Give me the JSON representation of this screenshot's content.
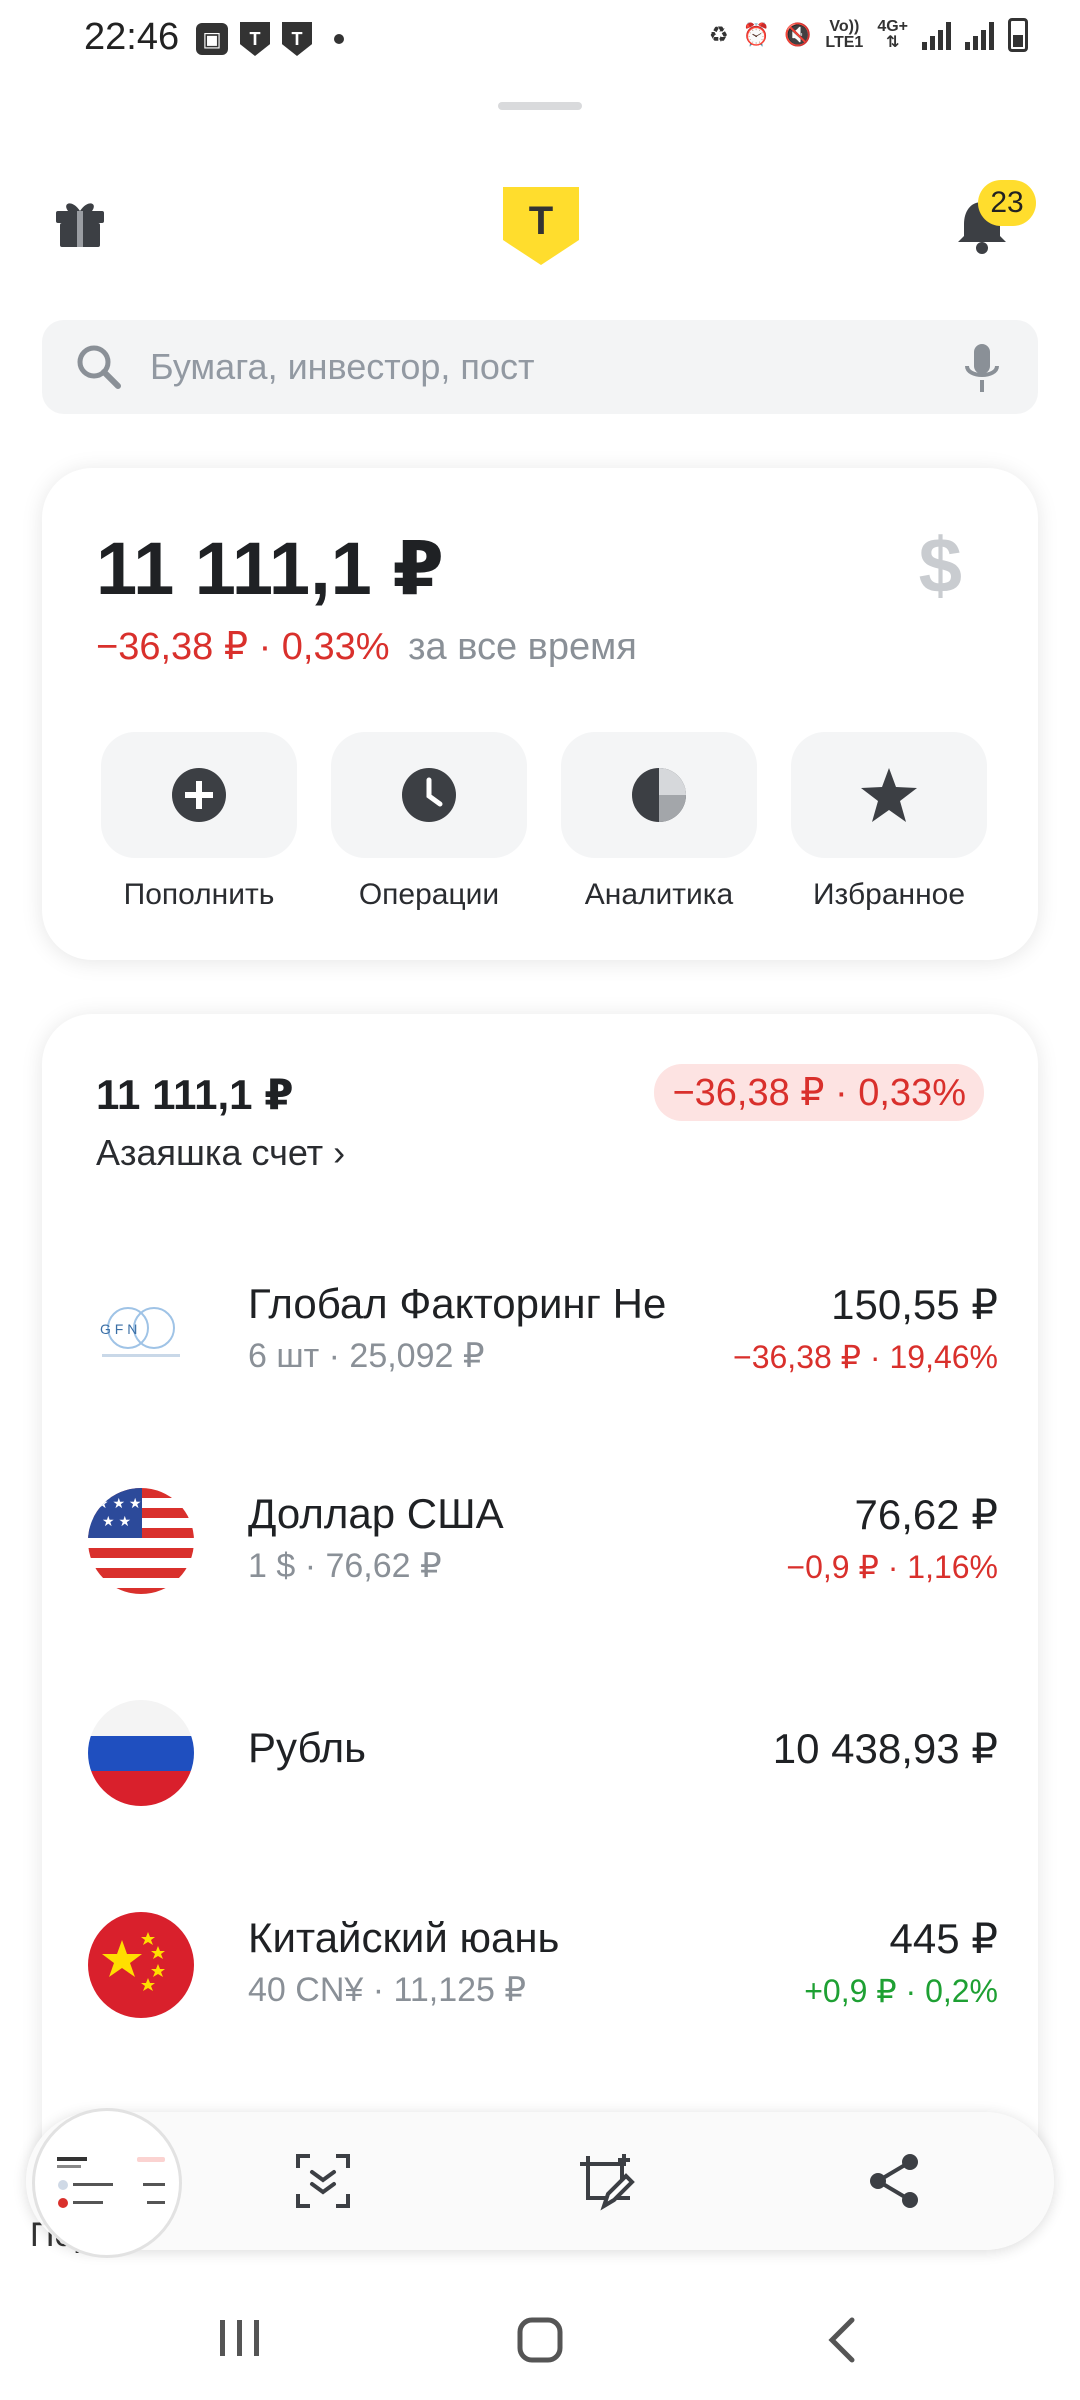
{
  "status_bar": {
    "time": "22:46",
    "network": "4G+",
    "volte": "Vo))",
    "lte": "LTE1"
  },
  "header": {
    "logo_letter": "T",
    "notifications_count": "23"
  },
  "search": {
    "placeholder": "Бумага, инвестор, пост"
  },
  "summary": {
    "total": "11 111,1 ₽",
    "change": "−36,38 ₽ · 0,33%",
    "period": "за все время",
    "currency_icon": "$",
    "actions": [
      {
        "label": "Пополнить",
        "icon": "plus-icon"
      },
      {
        "label": "Операции",
        "icon": "clock-icon"
      },
      {
        "label": "Аналитика",
        "icon": "pie-icon"
      },
      {
        "label": "Избранное",
        "icon": "star-icon"
      }
    ]
  },
  "account": {
    "total": "11 111,1 ₽",
    "change_badge": "−36,38 ₽ · 0,33%",
    "name": "Азаяшка счет ›",
    "positions": [
      {
        "name": "Глобал Факторинг Не",
        "sub": "6 шт · 25,092 ₽",
        "value": "150,55 ₽",
        "change": "−36,38 ₽ · 19,46%",
        "trend": "down",
        "logo_text": "G F N"
      },
      {
        "name": "Доллар США",
        "sub": "1 $ · 76,62 ₽",
        "value": "76,62 ₽",
        "change": "−0,9 ₽ · 1,16%",
        "trend": "down"
      },
      {
        "name": "Рубль",
        "sub": "",
        "value": "10 438,93 ₽",
        "change": "",
        "trend": "none"
      },
      {
        "name": "Китайский юань",
        "sub": "40 CN¥ · 11,125 ₽",
        "value": "445 ₽",
        "change": "+0,9 ₽ · 0,2%",
        "trend": "up"
      }
    ]
  },
  "bottom_nav": {
    "partial_label": "Пор"
  },
  "colors": {
    "brand_yellow": "#ffdd2d",
    "negative": "#d9302c",
    "positive": "#1ea033"
  }
}
